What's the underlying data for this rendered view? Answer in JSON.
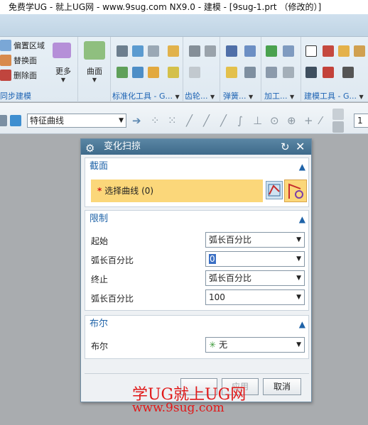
{
  "window": {
    "title": "免费学UG - 就上UG网 - www.9sug.com NX9.0 - 建模 - [9sug-1.prt （修改的）]"
  },
  "ribbon": {
    "sync_group": {
      "items": [
        "偏置区域",
        "替换面",
        "删除面"
      ],
      "label": "同步建模"
    },
    "more_label": "更多",
    "surface_label": "曲面",
    "groups": [
      "标准化工具 - G...",
      "齿轮...",
      "弹簧...",
      "加工...",
      "建模工具 - G..."
    ]
  },
  "cmdbar": {
    "filter_value": "特征曲线",
    "right_value": "1"
  },
  "dialog": {
    "title": "变化扫掠",
    "section": {
      "header": "截面",
      "select_label": "选择曲线 (0)",
      "required_mark": "*"
    },
    "limits": {
      "header": "限制",
      "start_label": "起始",
      "start_value": "弧长百分比",
      "start_pct_label": "弧长百分比",
      "start_pct_value": "0",
      "end_label": "终止",
      "end_value": "弧长百分比",
      "end_pct_label": "弧长百分比",
      "end_pct_value": "100"
    },
    "boolean": {
      "header": "布尔",
      "label": "布尔",
      "value": "无"
    },
    "buttons": {
      "apply": "应用",
      "cancel": "取消"
    }
  },
  "watermark": {
    "line1": "学UG就上UG网",
    "line2": "www.9sug.com"
  }
}
